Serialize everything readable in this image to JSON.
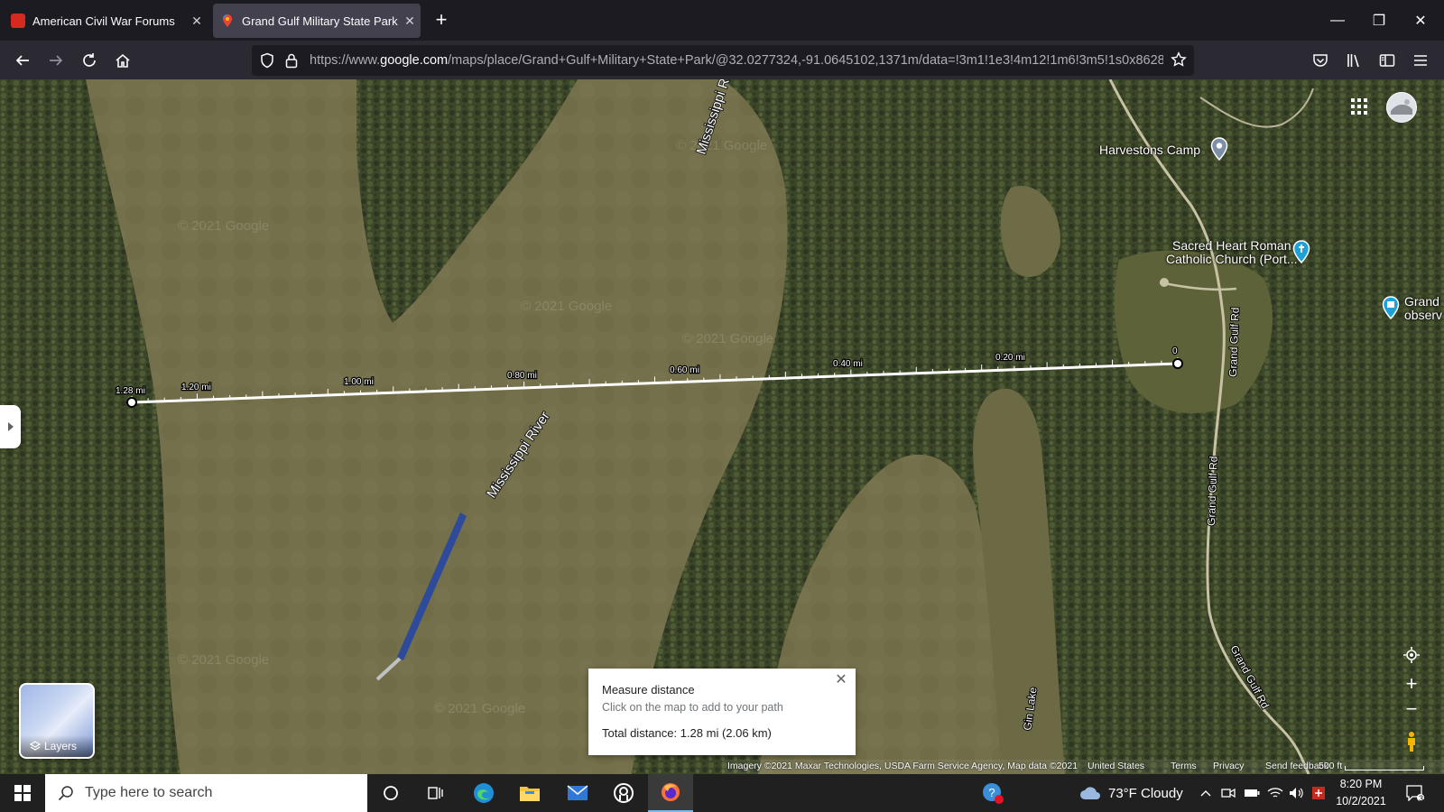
{
  "browser": {
    "tabs": [
      {
        "title": "American Civil War Forums",
        "active": false
      },
      {
        "title": "Grand Gulf Military State Park -",
        "active": true
      }
    ],
    "url_prefix": "https://www.",
    "url_domain": "google.com",
    "url_rest": "/maps/place/Grand+Gulf+Military+State+Park/@32.0277324,-91.0645102,1371m/data=!3m1!1e3!4m12!1m6!3m5!1s0x8628"
  },
  "map": {
    "places": {
      "harvestons": "Harvestons Camp",
      "church_line1": "Sacred Heart Roman",
      "church_line2": "Catholic Church (Port...",
      "grand_line1": "Grand",
      "grand_line2": "observ"
    },
    "roads": {
      "grand_gulf_1": "Grand Gulf Rd",
      "grand_gulf_2": "Grand Gulf Rd",
      "grand_gulf_3": "Grand Gulf Rd",
      "gin_lake": "Gin Lake"
    },
    "rivers": {
      "main": "Mississippi River",
      "top": "Mississippi R"
    },
    "watermark": "© 2021 Google",
    "measure_ticks": [
      "1.28 mi",
      "1.20 mi",
      "1.00 mi",
      "0.80 mi",
      "0.60 mi",
      "0.40 mi",
      "0.20 mi",
      "0"
    ],
    "layers_label": "Layers",
    "measure_panel": {
      "title": "Measure distance",
      "subtitle": "Click on the map to add to your path",
      "total": "Total distance: 1.28 mi (2.06 km)"
    },
    "footer": {
      "imagery": "Imagery ©2021 Maxar Technologies, USDA Farm Service Agency, Map data ©2021",
      "country": "United States",
      "terms": "Terms",
      "privacy": "Privacy",
      "feedback": "Send feedback",
      "scale": "500 ft"
    }
  },
  "taskbar": {
    "search_placeholder": "Type here to search",
    "weather": "73°F  Cloudy",
    "time": "8:20 PM",
    "date": "10/2/2021",
    "notification_count": "3"
  }
}
